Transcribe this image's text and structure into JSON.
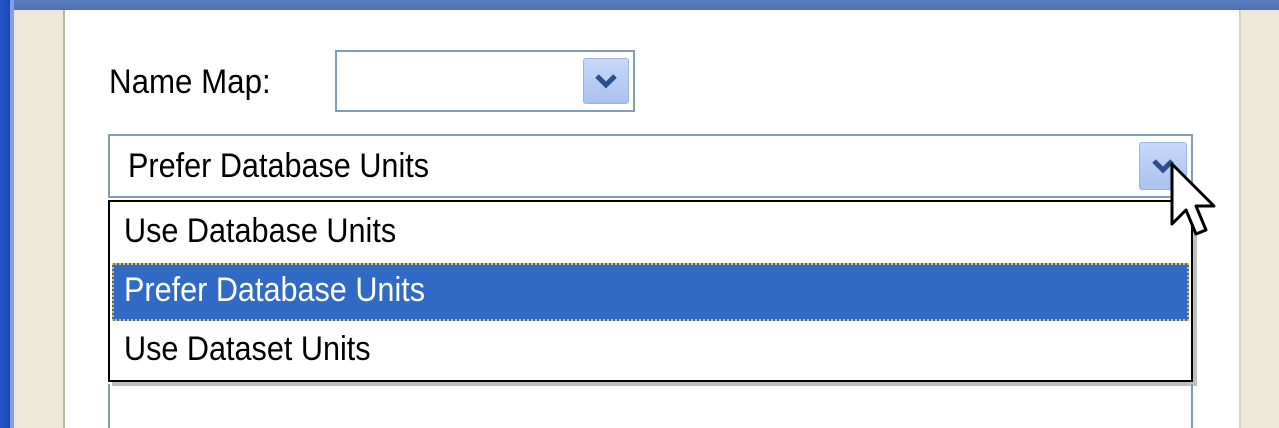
{
  "form": {
    "name_map_label": "Name Map:",
    "name_map_value": ""
  },
  "units_combo": {
    "selected_value": "Prefer Database Units",
    "options": [
      {
        "label": "Use Database Units",
        "selected": false
      },
      {
        "label": "Prefer Database Units",
        "selected": true
      },
      {
        "label": "Use Dataset Units",
        "selected": false
      }
    ]
  },
  "icons": {
    "dropdown": "chevron-down-icon",
    "cursor": "mouse-pointer-icon"
  },
  "colors": {
    "selection": "#316ac5",
    "focus_outline": "#e8c030",
    "combo_border": "#7f9db9",
    "window_bg": "#ece9d8"
  }
}
